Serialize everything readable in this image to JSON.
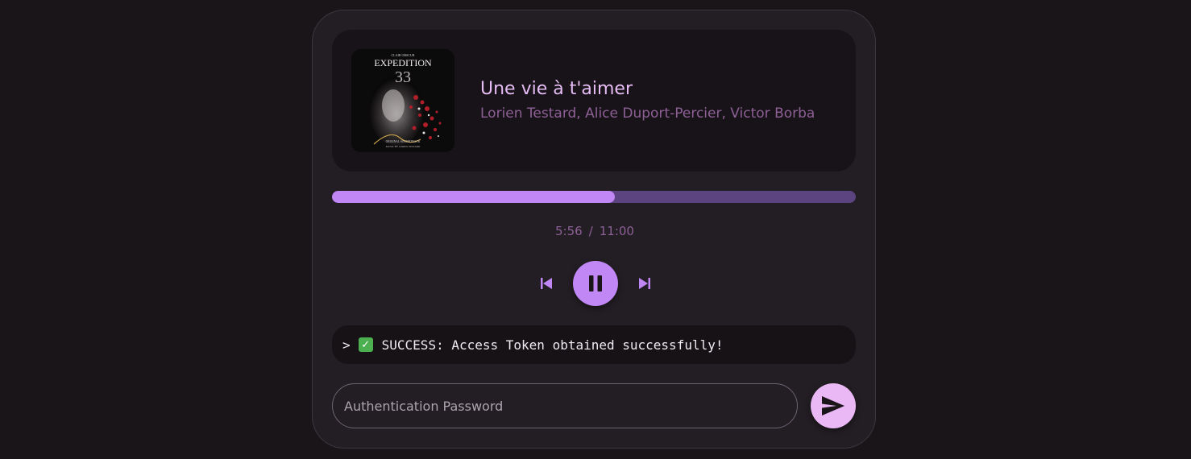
{
  "track": {
    "title": "Une vie à t'aimer",
    "artists": "Lorien Testard, Alice Duport-Percier, Victor Borba",
    "album_art": {
      "label_top": "CLAIR OBSCUR",
      "title": "EXPEDITION",
      "number": "33",
      "footer_1": "ORIGINAL SOUNDTRACK",
      "footer_2": "MUSIC BY LORIEN TESTARD"
    }
  },
  "playback": {
    "progress_fraction": 0.54,
    "current_time": "5:56",
    "separator": "/",
    "total_time": "11:00",
    "state": "playing"
  },
  "controls": {
    "prev_icon": "skip-previous-icon",
    "play_pause_icon": "pause-icon",
    "next_icon": "skip-next-icon"
  },
  "console": {
    "prompt": ">",
    "status_icon": "check-mark-icon",
    "message": "SUCCESS: Access Token obtained successfully!"
  },
  "auth": {
    "password_placeholder": "Authentication Password",
    "password_value": "",
    "send_icon": "send-icon"
  },
  "colors": {
    "accent": "#c187f5",
    "progress_track": "#5c4480",
    "title": "#e6bcf5",
    "subtitle": "#8d6096",
    "send_button": "#eab9f5",
    "success": "#4caf50"
  }
}
